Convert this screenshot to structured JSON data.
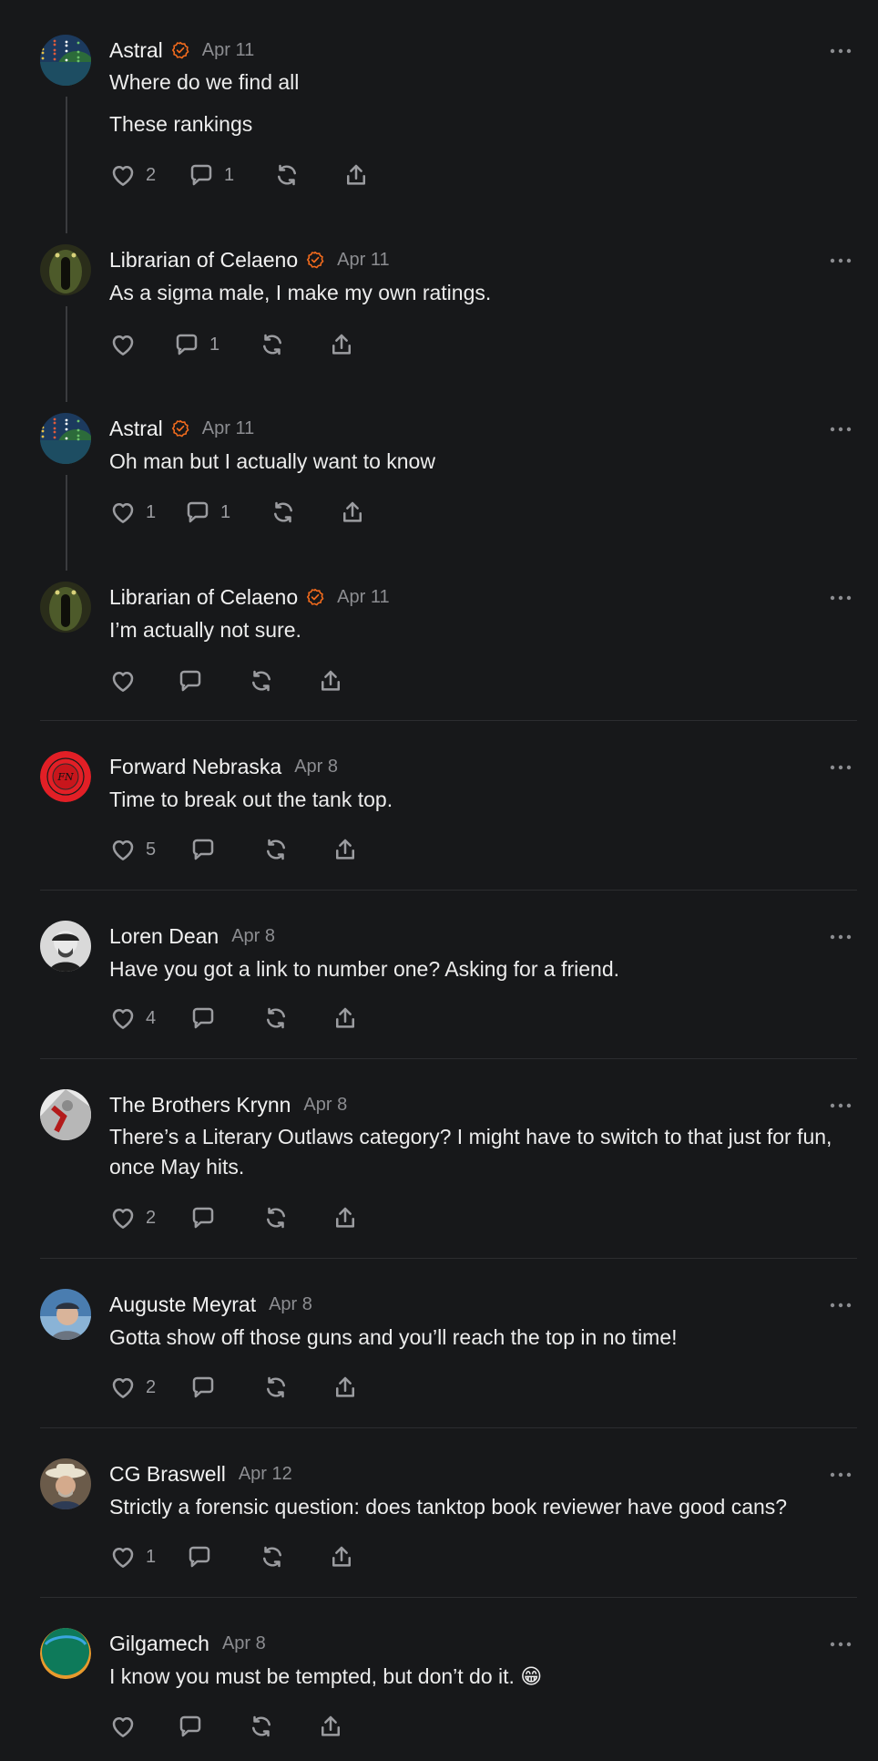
{
  "posts": [
    {
      "author": "Astral",
      "verified": true,
      "date": "Apr 11",
      "lines": [
        "Where do we find all",
        "These rankings"
      ],
      "likes": "2",
      "comments": "1",
      "avatar": "avatar-astral"
    },
    {
      "author": "Librarian of Celaeno",
      "verified": true,
      "date": "Apr 11",
      "lines": [
        "As a sigma male, I make my own ratings."
      ],
      "likes": "",
      "comments": "1",
      "avatar": "avatar-librarian"
    },
    {
      "author": "Astral",
      "verified": true,
      "date": "Apr 11",
      "lines": [
        "Oh man but I actually want to know"
      ],
      "likes": "1",
      "comments": "1",
      "avatar": "avatar-astral"
    },
    {
      "author": "Librarian of Celaeno",
      "verified": true,
      "date": "Apr 11",
      "lines": [
        "I’m actually not sure."
      ],
      "likes": "",
      "comments": "",
      "avatar": "avatar-librarian"
    },
    {
      "author": "Forward Nebraska",
      "verified": false,
      "date": "Apr 8",
      "lines": [
        "Time to break out the tank top."
      ],
      "likes": "5",
      "comments": "",
      "avatar": "avatar-forward-nebraska"
    },
    {
      "author": "Loren Dean",
      "verified": false,
      "date": "Apr 8",
      "lines": [
        "Have you got a link to number one? Asking for a friend."
      ],
      "likes": "4",
      "comments": "",
      "avatar": "avatar-loren"
    },
    {
      "author": "The Brothers Krynn",
      "verified": false,
      "date": "Apr 8",
      "lines": [
        "There’s a Literary Outlaws category? I might have to switch to that just for fun, once May hits."
      ],
      "likes": "2",
      "comments": "",
      "avatar": "avatar-krynn"
    },
    {
      "author": "Auguste Meyrat",
      "verified": false,
      "date": "Apr 8",
      "lines": [
        "Gotta show off those guns and you’ll reach the top in no time!"
      ],
      "likes": "2",
      "comments": "",
      "avatar": "avatar-auguste"
    },
    {
      "author": "CG Braswell",
      "verified": false,
      "date": "Apr 12",
      "lines": [
        "Strictly a forensic question: does tanktop book reviewer have good cans?"
      ],
      "likes": "1",
      "comments": "",
      "avatar": "avatar-cg"
    },
    {
      "author": "Gilgamech",
      "verified": false,
      "date": "Apr 8",
      "lines": [
        "I know you must be tempted, but don’t do it. 😁"
      ],
      "likes": "",
      "comments": "",
      "avatar": "avatar-gilgamech"
    }
  ],
  "colors": {
    "accent_verified": "#f26b1d",
    "background": "#17181a",
    "muted": "#8c8d91"
  },
  "icons": [
    "heart-icon",
    "comment-icon",
    "restack-icon",
    "share-icon",
    "more-icon",
    "verified-icon"
  ]
}
